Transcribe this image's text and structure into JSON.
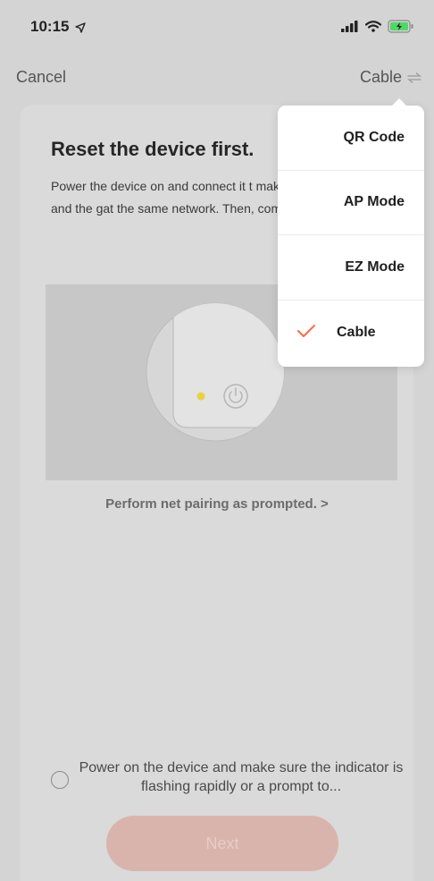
{
  "status_bar": {
    "time": "10:15"
  },
  "nav": {
    "cancel_label": "Cancel",
    "mode_label": "Cable"
  },
  "card": {
    "title": "Reset the device first.",
    "description": "Power the device on and connect it t making sure your phone and the gat the same network. Then, comfirm th are on.",
    "net_pairing_link": "Perform net pairing as prompted. >"
  },
  "confirm": {
    "text": "Power on the device and make sure the indicator is flashing rapidly or a prompt to...",
    "checked": false
  },
  "next_button": {
    "label": "Next"
  },
  "dropdown": {
    "items": [
      {
        "label": "QR Code",
        "selected": false
      },
      {
        "label": "AP Mode",
        "selected": false
      },
      {
        "label": "EZ Mode",
        "selected": false
      },
      {
        "label": "Cable",
        "selected": true
      }
    ]
  },
  "colors": {
    "accent": "#ff6a3d",
    "indicator_led": "#e8d33a",
    "next_button_bg": "#d9b4ad"
  },
  "icons": {
    "location": "location-arrow-icon",
    "signal": "cellular-signal-icon",
    "wifi": "wifi-icon",
    "battery": "battery-charging-icon",
    "switch": "switch-arrows-icon",
    "check": "checkmark-icon",
    "power": "power-icon"
  }
}
